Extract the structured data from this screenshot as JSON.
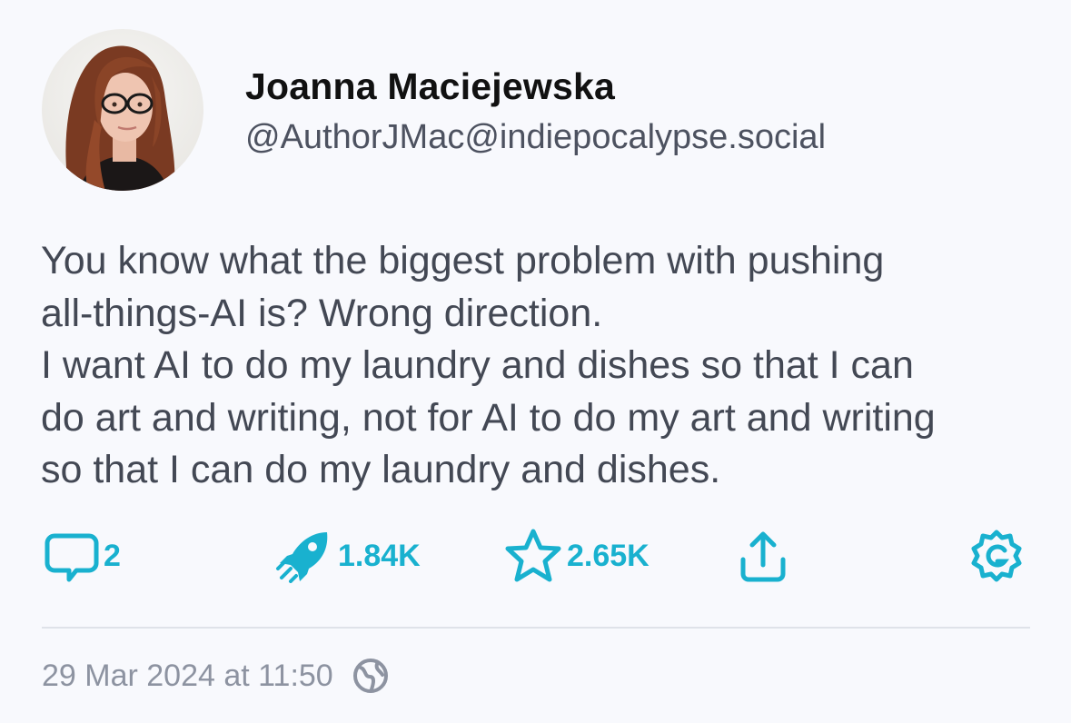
{
  "author": {
    "display_name": "Joanna Maciejewska",
    "handle": "@AuthorJMac@indiepocalypse.social",
    "avatar_icon": "profile-photo"
  },
  "post": {
    "text": "You know what the biggest problem with pushing\nall-things-AI is? Wrong direction.\nI want AI to do my laundry and dishes so that I can\ndo art and writing, not for AI to do my art and writing\nso that I can do my laundry and dishes."
  },
  "actions": {
    "replies": {
      "icon": "reply-icon",
      "count": "2"
    },
    "boosts": {
      "icon": "rocket-icon",
      "count": "1.84K"
    },
    "favourites": {
      "icon": "star-icon",
      "count": "2.65K"
    },
    "share": {
      "icon": "share-icon"
    },
    "more": {
      "icon": "settings-icon"
    }
  },
  "meta": {
    "timestamp": "29 Mar 2024 at 11:50",
    "visibility_icon": "globe-icon"
  },
  "colors": {
    "accent": "#19b1cf",
    "background": "#f8f9fd",
    "text": "#434854",
    "muted": "#8d93a1"
  }
}
